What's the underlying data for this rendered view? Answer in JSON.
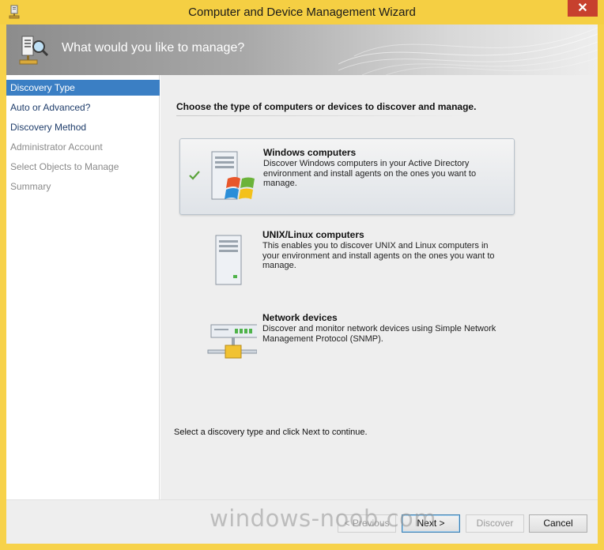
{
  "window": {
    "title": "Computer and Device Management Wizard",
    "close_label": "✕"
  },
  "header": {
    "title": "What would you like to manage?"
  },
  "nav": {
    "items": [
      {
        "label": "Discovery Type",
        "state": "active"
      },
      {
        "label": "Auto or Advanced?",
        "state": "enabled"
      },
      {
        "label": "Discovery Method",
        "state": "enabled"
      },
      {
        "label": "Administrator Account",
        "state": "disabled"
      },
      {
        "label": "Select Objects to Manage",
        "state": "disabled"
      },
      {
        "label": "Summary",
        "state": "disabled"
      }
    ]
  },
  "main": {
    "heading": "Choose the type of computers or devices to discover and manage.",
    "options": [
      {
        "title": "Windows computers",
        "description": "Discover Windows computers in your Active Directory environment and install agents on the ones you want to manage.",
        "selected": true,
        "icon": "windows-server-icon"
      },
      {
        "title": "UNIX/Linux computers",
        "description": "This enables you to discover UNIX and Linux computers in your environment and install agents on the ones you want to manage.",
        "selected": false,
        "icon": "unix-server-icon"
      },
      {
        "title": "Network devices",
        "description": "Discover and monitor network devices using Simple Network Management Protocol (SNMP).",
        "selected": false,
        "icon": "network-device-icon"
      }
    ],
    "footer": "Select a discovery type and click Next to continue."
  },
  "buttons": {
    "previous": "< Previous",
    "next": "Next >",
    "discover": "Discover",
    "cancel": "Cancel"
  },
  "watermark": "windows-noob.com",
  "colors": {
    "title_bar": "#f5cf43",
    "nav_active": "#3b7fc4",
    "close_button": "#c7402e"
  }
}
